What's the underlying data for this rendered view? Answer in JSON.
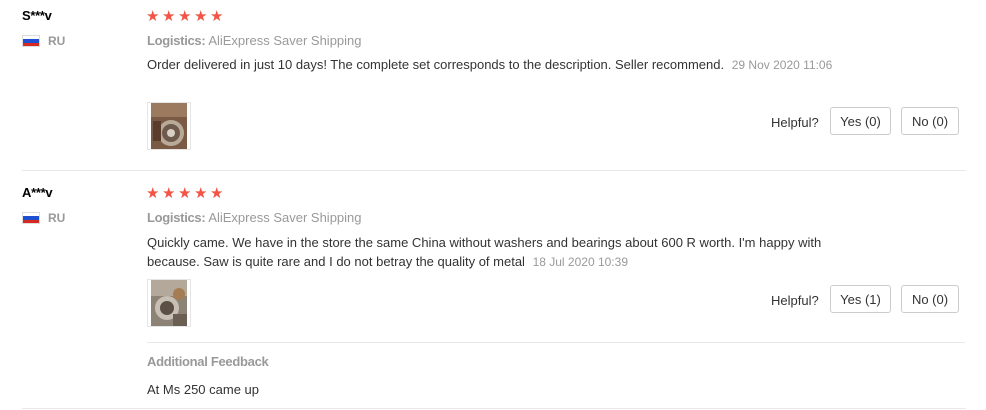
{
  "reviews": [
    {
      "user": "S***v",
      "country": "RU",
      "stars": 5,
      "logistics_label": "Logistics:",
      "logistics_value": "AliExpress Saver Shipping",
      "comment": "Order delivered in just 10 days! The complete set corresponds to the description. Seller recommend.",
      "date": "29 Nov 2020 11:06",
      "helpful_label": "Helpful?",
      "yes_label": "Yes (0)",
      "no_label": "No (0)"
    },
    {
      "user": "A***v",
      "country": "RU",
      "stars": 5,
      "logistics_label": "Logistics:",
      "logistics_value": "AliExpress Saver Shipping",
      "comment": "Quickly came. We have in the store the same China without washers and bearings about 600 R worth. I'm happy with because. Saw is quite rare and I do not betray the quality of metal",
      "date": "18 Jul 2020 10:39",
      "helpful_label": "Helpful?",
      "yes_label": "Yes (1)",
      "no_label": "No (0)",
      "additional_feedback_title": "Additional Feedback",
      "additional_feedback_text": "At Ms 250 came up"
    }
  ],
  "colors": {
    "star": "#f25545",
    "muted": "#999999",
    "text": "#333333",
    "divider": "#e8e8e8"
  },
  "icons": {
    "star": "star-icon",
    "flag": "russia-flag-icon"
  }
}
